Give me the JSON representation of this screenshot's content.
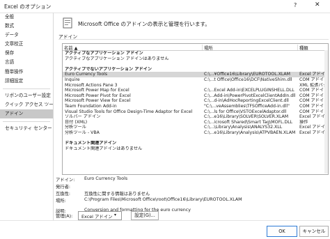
{
  "window": {
    "title": "Excel のオプション",
    "help": "?",
    "close": "✕"
  },
  "sidebar": {
    "items": [
      "全般",
      "数式",
      "データ",
      "文章校正",
      "保存",
      "言語",
      "簡単操作",
      "詳細設定",
      "リボンのユーザー設定",
      "クイック アクセス ツール バー",
      "アドイン",
      "セキュリティ センター"
    ],
    "selected": "アドイン"
  },
  "header": {
    "text": "Microsoft Office のアドインの表示と管理を行います。"
  },
  "section": {
    "label": "アドイン"
  },
  "table": {
    "columns": [
      "名前 ▲",
      "場所",
      "種類"
    ],
    "rows": [
      {
        "kind": "group",
        "name": "アクティブなアプリケーション アドイン"
      },
      {
        "kind": "note",
        "name": "アクティブなアプリケーション アドインはありません"
      },
      {
        "kind": "spacer",
        "name": ""
      },
      {
        "kind": "group",
        "name": "アクティブでないアプリケーション アドイン"
      },
      {
        "kind": "item",
        "name": "Euro Currency Tools",
        "location": "C:\\...¥Office16\\Library\\EUROTOOL.XLAM",
        "type": "Excel アドイン",
        "selected": true
      },
      {
        "kind": "item",
        "name": "Inquire",
        "location": "C:\\...t Office\\Office16\\DCF\\NativeShim.dll",
        "type": "COM アドイン"
      },
      {
        "kind": "item",
        "name": "Microsoft Actions Pane 3",
        "location": "",
        "type": "XML 拡張パック"
      },
      {
        "kind": "item",
        "name": "Microsoft Power Map for Excel",
        "location": "C:\\...Excel Add-in\\EXCELPLUGINSHELL.DLL",
        "type": "COM アドイン"
      },
      {
        "kind": "item",
        "name": "Microsoft Power Pivot for Excel",
        "location": "C:\\...Add-in\\PowerPivotExcelClientAddIn.dll",
        "type": "COM アドイン"
      },
      {
        "kind": "item",
        "name": "Microsoft Power View for Excel",
        "location": "C:\\...d-in\\AdHocReportingExcelClient.dll",
        "type": "COM アドイン"
      },
      {
        "kind": "item",
        "name": "Team Foundation Add-in",
        "location": "\"C:\\...veAssemblies\\TFSOfficeAdd-in.dll\"",
        "type": "COM アドイン"
      },
      {
        "kind": "item",
        "name": "Visual Studio Tools for Office Design-Time Adaptor for Excel",
        "location": "C:\\...ls for Office\\VSTOExcelAdaptor.dll",
        "type": "COM アドイン"
      },
      {
        "kind": "item",
        "name": "ソルバー アドイン",
        "location": "C:\\...e16\\Library\\SOLVER\\SOLVER.XLAM",
        "type": "Excel アドイン"
      },
      {
        "kind": "item",
        "name": "日付 (XML)",
        "location": "C:\\...icrosoft Shared\\Smart Tag\\MOFL.DLL",
        "type": "操作"
      },
      {
        "kind": "item",
        "name": "分析ツール",
        "location": "C:\\...\\Library\\Analysis\\ANALYS32.XLL",
        "type": "Excel アドイン"
      },
      {
        "kind": "item",
        "name": "分析ツール - VBA",
        "location": "C:\\...e16\\Library\\Analysis\\ATPVBAEN.XLAM",
        "type": "Excel アドイン"
      },
      {
        "kind": "spacer",
        "name": ""
      },
      {
        "kind": "group",
        "name": "ドキュメント関連アドイン"
      },
      {
        "kind": "note",
        "name": "ドキュメント関連アドインはありません"
      }
    ]
  },
  "details": {
    "addin_label": "アドイン:",
    "addin_value": "Euro Currency Tools",
    "publisher_label": "発行者:",
    "publisher_value": "",
    "compat_label": "互換性:",
    "compat_value": "互換性に関する情報はありません",
    "location_label": "場所:",
    "location_value": "C:\\Program Files\\Microsoft Office\\root\\Office16\\Library\\EUROTOOL.XLAM",
    "desc_label": "説明:",
    "desc_value": "Conversion and formatting for the euro currency"
  },
  "manage": {
    "label": "管理(A):",
    "selected": "Excel アドイン",
    "go_label": "設定(G)..."
  },
  "footer": {
    "ok_label": "OK",
    "cancel_label": "キャンセル"
  }
}
